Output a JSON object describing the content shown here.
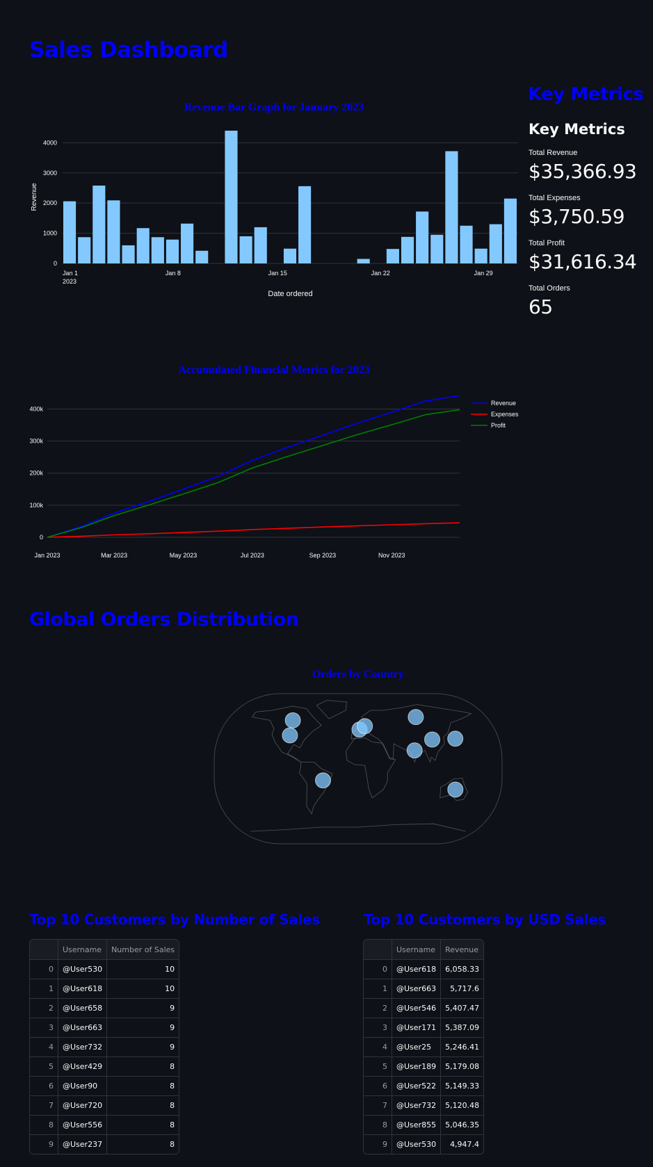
{
  "page": {
    "title": "Sales Dashboard",
    "metrics_heading": "Key Metrics",
    "global_heading": "Global Orders Distribution"
  },
  "metrics": {
    "subheading": "Key Metrics",
    "items": [
      {
        "label": "Total Revenue",
        "value": "$35,366.93"
      },
      {
        "label": "Total Expenses",
        "value": "$3,750.59"
      },
      {
        "label": "Total Profit",
        "value": "$31,616.34"
      },
      {
        "label": "Total Orders",
        "value": "65"
      }
    ]
  },
  "colors": {
    "background": "#0e1117",
    "heading": "#0000ff",
    "bar": "#83c9ff",
    "revenue_line": "#0000ff",
    "expenses_line": "#ff0000",
    "profit_line": "#008000",
    "bubble": "#83c9ff"
  },
  "chart_data": [
    {
      "type": "bar",
      "title": "Revenue Bar Graph for January 2023",
      "xlabel": "Date ordered",
      "ylabel": "Revenue",
      "ylim": [
        0,
        4400
      ],
      "yticks": [
        0,
        1000,
        2000,
        3000,
        4000
      ],
      "xticks": [
        "Jan 1\n2023",
        "Jan 8",
        "Jan 15",
        "Jan 22",
        "Jan 29"
      ],
      "xtick_days": [
        1,
        8,
        15,
        22,
        29
      ],
      "days": [
        1,
        2,
        3,
        4,
        5,
        6,
        7,
        8,
        9,
        10,
        11,
        12,
        13,
        14,
        15,
        16,
        17,
        18,
        19,
        20,
        21,
        22,
        23,
        24,
        25,
        26,
        27,
        28,
        29,
        30,
        31
      ],
      "values": [
        2060,
        870,
        2580,
        2090,
        600,
        1170,
        870,
        790,
        1320,
        420,
        0,
        4400,
        900,
        1200,
        0,
        490,
        2560,
        0,
        0,
        0,
        150,
        0,
        480,
        880,
        1720,
        950,
        3720,
        1250,
        490,
        1300,
        2150
      ],
      "grid": true
    },
    {
      "type": "line",
      "title": "Accumulated Financial Metrics for 2023",
      "xlabel": "",
      "ylabel": "",
      "x": [
        "2023-01-01",
        "2023-02-01",
        "2023-03-01",
        "2023-04-01",
        "2023-05-01",
        "2023-06-01",
        "2023-07-01",
        "2023-08-01",
        "2023-09-01",
        "2023-10-01",
        "2023-11-01",
        "2023-12-01",
        "2023-12-31"
      ],
      "xticks": [
        "Jan 2023",
        "Mar 2023",
        "May 2023",
        "Jul 2023",
        "Sep 2023",
        "Nov 2023"
      ],
      "yticks": [
        "0",
        "100k",
        "200k",
        "300k",
        "400k"
      ],
      "ylim": [
        0,
        440000
      ],
      "series": [
        {
          "name": "Revenue",
          "values": [
            0,
            35000,
            75000,
            112000,
            150000,
            190000,
            240000,
            280000,
            318000,
            355000,
            390000,
            425000,
            442000
          ]
        },
        {
          "name": "Expenses",
          "values": [
            0,
            3500,
            7500,
            11000,
            15000,
            19000,
            24000,
            28000,
            32000,
            35500,
            39000,
            42500,
            45000
          ]
        },
        {
          "name": "Profit",
          "values": [
            0,
            31500,
            67500,
            101000,
            135000,
            171000,
            216000,
            252000,
            286000,
            319500,
            351000,
            382500,
            398000
          ]
        }
      ],
      "legend_position": "top-right",
      "grid": true
    },
    {
      "type": "scatter",
      "title": "Orders by Country",
      "projection": "natural earth",
      "points": [
        {
          "lon": -100,
          "lat": 58
        },
        {
          "lon": -98,
          "lat": 40
        },
        {
          "lon": -48,
          "lat": -14
        },
        {
          "lon": 2,
          "lat": 47
        },
        {
          "lon": 10,
          "lat": 51
        },
        {
          "lon": 90,
          "lat": 62
        },
        {
          "lon": 78,
          "lat": 22
        },
        {
          "lon": 105,
          "lat": 35
        },
        {
          "lon": 138,
          "lat": 36
        },
        {
          "lon": 135,
          "lat": -25
        }
      ]
    }
  ],
  "table1": {
    "heading": "Top 10 Customers by Number of Sales",
    "columns": [
      "",
      "Username",
      "Number of Sales"
    ],
    "rows": [
      [
        "0",
        "@User530",
        "10"
      ],
      [
        "1",
        "@User618",
        "10"
      ],
      [
        "2",
        "@User658",
        "9"
      ],
      [
        "3",
        "@User663",
        "9"
      ],
      [
        "4",
        "@User732",
        "9"
      ],
      [
        "5",
        "@User429",
        "8"
      ],
      [
        "6",
        "@User90",
        "8"
      ],
      [
        "7",
        "@User720",
        "8"
      ],
      [
        "8",
        "@User556",
        "8"
      ],
      [
        "9",
        "@User237",
        "8"
      ]
    ]
  },
  "table2": {
    "heading": "Top 10 Customers by USD Sales",
    "columns": [
      "",
      "Username",
      "Revenue"
    ],
    "rows": [
      [
        "0",
        "@User618",
        "6,058.33"
      ],
      [
        "1",
        "@User663",
        "5,717.6"
      ],
      [
        "2",
        "@User546",
        "5,407.47"
      ],
      [
        "3",
        "@User171",
        "5,387.09"
      ],
      [
        "4",
        "@User25",
        "5,246.41"
      ],
      [
        "5",
        "@User189",
        "5,179.08"
      ],
      [
        "6",
        "@User522",
        "5,149.33"
      ],
      [
        "7",
        "@User732",
        "5,120.48"
      ],
      [
        "8",
        "@User855",
        "5,046.35"
      ],
      [
        "9",
        "@User530",
        "4,947.4"
      ]
    ]
  }
}
